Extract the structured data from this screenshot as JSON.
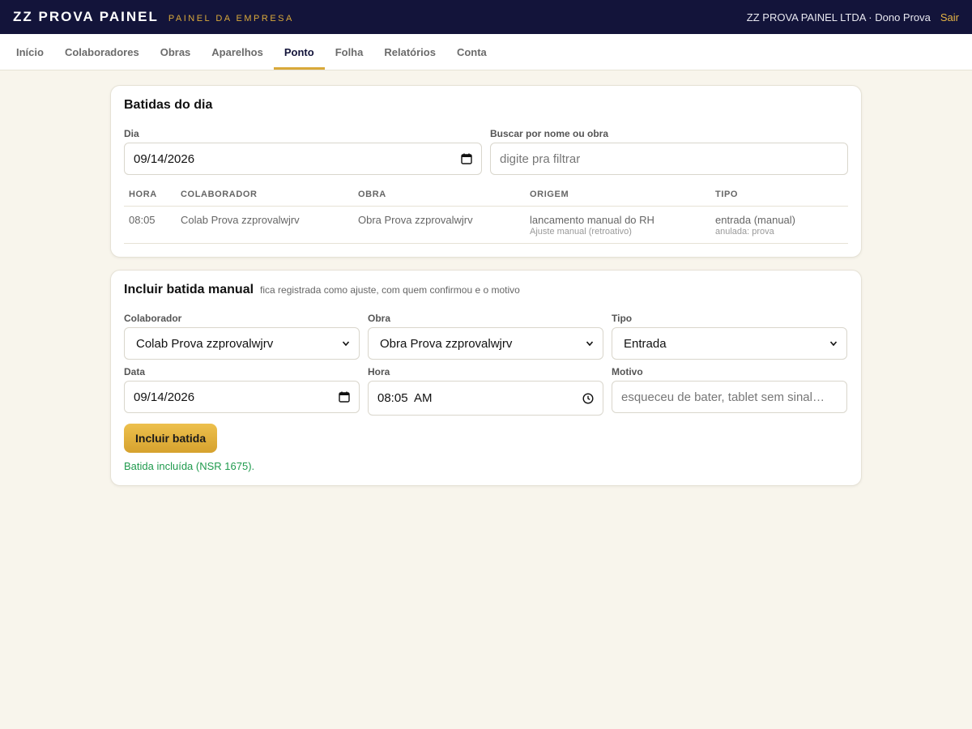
{
  "header": {
    "brand": "ZZ PROVA PAINEL",
    "subtitle": "PAINEL DA EMPRESA",
    "company_user": "ZZ PROVA PAINEL LTDA · Dono Prova",
    "logout": "Sair"
  },
  "nav": {
    "tabs": [
      {
        "label": "Início"
      },
      {
        "label": "Colaboradores"
      },
      {
        "label": "Obras"
      },
      {
        "label": "Aparelhos"
      },
      {
        "label": "Ponto",
        "active": true
      },
      {
        "label": "Folha"
      },
      {
        "label": "Relatórios"
      },
      {
        "label": "Conta"
      }
    ]
  },
  "punches": {
    "title": "Batidas do dia",
    "day_label": "Dia",
    "day_value": "09/14/2026",
    "search_label": "Buscar por nome ou obra",
    "search_placeholder": "digite pra filtrar",
    "columns": [
      "HORA",
      "COLABORADOR",
      "OBRA",
      "ORIGEM",
      "TIPO"
    ],
    "rows": [
      {
        "hora": "08:05",
        "colaborador": "Colab Prova zzprovalwjrv",
        "obra": "Obra Prova zzprovalwjrv",
        "origem": "lancamento manual do RH",
        "origem_sub": "Ajuste manual (retroativo)",
        "tipo": "entrada (manual)",
        "tipo_sub": "anulada: prova"
      }
    ]
  },
  "manual": {
    "title": "Incluir batida manual",
    "hint": "fica registrada como ajuste, com quem confirmou e o motivo",
    "colaborador_label": "Colaborador",
    "colaborador_value": "Colab Prova zzprovalwjrv",
    "obra_label": "Obra",
    "obra_value": "Obra Prova zzprovalwjrv",
    "tipo_label": "Tipo",
    "tipo_value": "Entrada",
    "data_label": "Data",
    "data_value": "09/14/2026",
    "hora_label": "Hora",
    "hora_value": "08:05  AM",
    "motivo_label": "Motivo",
    "motivo_placeholder": "esqueceu de bater, tablet sem sinal…",
    "submit_label": "Incluir batida",
    "success_message": "Batida incluída (NSR 1675)."
  },
  "colors": {
    "topbar": "#13143a",
    "accent": "#d9a93a",
    "success": "#1f9a4d"
  }
}
